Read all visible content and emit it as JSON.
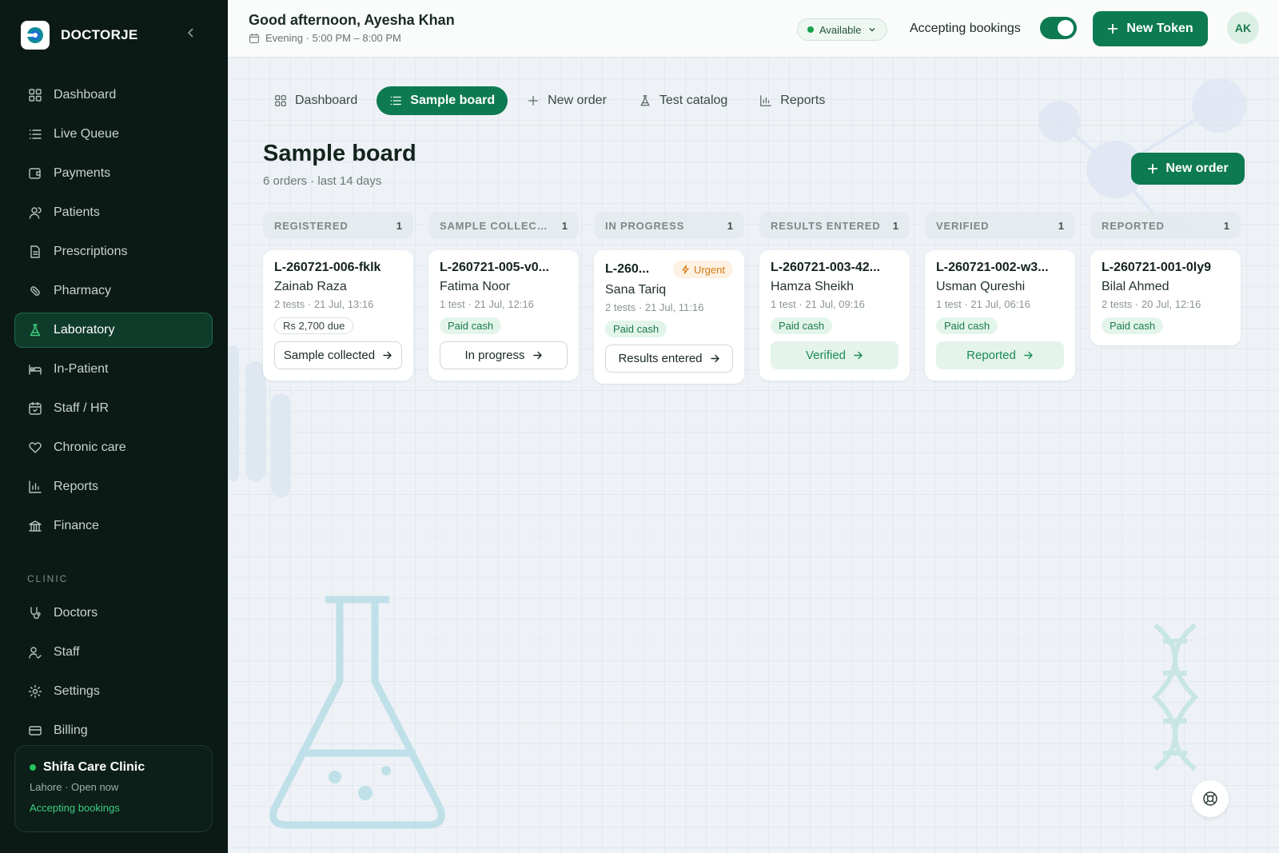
{
  "brand": {
    "name": "DOCTORJE"
  },
  "sidebar": {
    "items": [
      {
        "label": "Dashboard",
        "icon": "grid-icon"
      },
      {
        "label": "Live Queue",
        "icon": "list-icon"
      },
      {
        "label": "Payments",
        "icon": "wallet-icon"
      },
      {
        "label": "Patients",
        "icon": "users-icon"
      },
      {
        "label": "Prescriptions",
        "icon": "file-icon"
      },
      {
        "label": "Pharmacy",
        "icon": "pill-icon"
      },
      {
        "label": "Laboratory",
        "icon": "flask-icon",
        "active": true
      },
      {
        "label": "In-Patient",
        "icon": "bed-icon"
      },
      {
        "label": "Staff / HR",
        "icon": "calendar-icon"
      },
      {
        "label": "Chronic care",
        "icon": "heart-icon"
      },
      {
        "label": "Reports",
        "icon": "bar-chart-icon"
      },
      {
        "label": "Finance",
        "icon": "bank-icon"
      }
    ],
    "section_label": "CLINIC",
    "clinic_items": [
      {
        "label": "Doctors",
        "icon": "stethoscope-icon"
      },
      {
        "label": "Staff",
        "icon": "user-icon"
      },
      {
        "label": "Settings",
        "icon": "gear-icon"
      },
      {
        "label": "Billing",
        "icon": "card-icon"
      }
    ],
    "clinic": {
      "name": "Shifa Care Clinic",
      "location": "Lahore · Open now",
      "status": "Accepting bookings"
    }
  },
  "topbar": {
    "greeting": "Good afternoon, Ayesha Khan",
    "shift": "Evening · 5:00 PM – 8:00 PM",
    "availability": "Available",
    "accepting_label": "Accepting bookings",
    "accepting_on": true,
    "new_token": "New Token",
    "avatar": "AK"
  },
  "tabs": [
    {
      "label": "Dashboard",
      "icon": "grid-icon"
    },
    {
      "label": "Sample board",
      "icon": "list-icon",
      "active": true
    },
    {
      "label": "New order",
      "icon": "plus-icon"
    },
    {
      "label": "Test catalog",
      "icon": "flask-icon"
    },
    {
      "label": "Reports",
      "icon": "bar-chart-icon"
    }
  ],
  "page": {
    "title": "Sample board",
    "subtitle": "6 orders · last 14 days",
    "new_order": "New order"
  },
  "board": {
    "columns": [
      {
        "title": "REGISTERED",
        "count": "1",
        "cards": [
          {
            "id": "L-260721-006-fklk",
            "patient": "Zainab Raza",
            "meta": "2 tests · 21 Jul, 13:16",
            "badge": "Rs 2,700 due",
            "badge_type": "due",
            "action": "Sample collected",
            "action_done": false
          }
        ]
      },
      {
        "title": "SAMPLE COLLECTED",
        "count": "1",
        "cards": [
          {
            "id": "L-260721-005-v0...",
            "patient": "Fatima Noor",
            "meta": "1 test · 21 Jul, 12:16",
            "badge": "Paid cash",
            "badge_type": "paid",
            "action": "In progress",
            "action_done": false
          }
        ]
      },
      {
        "title": "IN PROGRESS",
        "count": "1",
        "cards": [
          {
            "id": "L-260...",
            "urgent": "Urgent",
            "patient": "Sana Tariq",
            "meta": "2 tests · 21 Jul, 11:16",
            "badge": "Paid cash",
            "badge_type": "paid",
            "action": "Results entered",
            "action_done": false
          }
        ]
      },
      {
        "title": "RESULTS ENTERED",
        "count": "1",
        "cards": [
          {
            "id": "L-260721-003-42...",
            "patient": "Hamza Sheikh",
            "meta": "1 test · 21 Jul, 09:16",
            "badge": "Paid cash",
            "badge_type": "paid",
            "action": "Verified",
            "action_done": true
          }
        ]
      },
      {
        "title": "VERIFIED",
        "count": "1",
        "cards": [
          {
            "id": "L-260721-002-w3...",
            "patient": "Usman Qureshi",
            "meta": "1 test · 21 Jul, 06:16",
            "badge": "Paid cash",
            "badge_type": "paid",
            "action": "Reported",
            "action_done": true
          }
        ]
      },
      {
        "title": "REPORTED",
        "count": "1",
        "cards": [
          {
            "id": "L-260721-001-0ly9",
            "patient": "Bilal Ahmed",
            "meta": "2 tests · 20 Jul, 12:16",
            "badge": "Paid cash",
            "badge_type": "paid"
          }
        ]
      }
    ]
  },
  "colors": {
    "accent": "#0e7a52",
    "sidebar_bg": "#0b1a15",
    "urgent": "#d27a16"
  }
}
